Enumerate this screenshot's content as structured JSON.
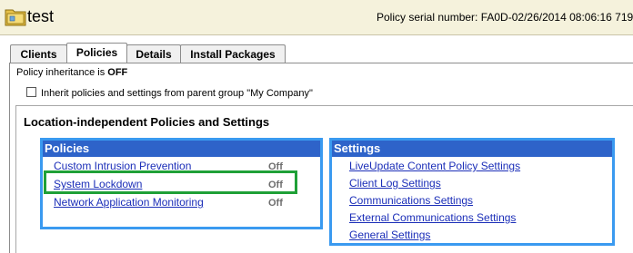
{
  "header": {
    "title": "test",
    "serial_label": "Policy serial number: FA0D-02/26/2014 08:06:16 719"
  },
  "tabs": [
    {
      "label": "Clients",
      "active": false
    },
    {
      "label": "Policies",
      "active": true
    },
    {
      "label": "Details",
      "active": false
    },
    {
      "label": "Install Packages",
      "active": false
    }
  ],
  "inheritance": {
    "status_prefix": "Policy inheritance is ",
    "status_value": "OFF",
    "checkbox_label": "Inherit policies and settings from parent group \"My Company\"",
    "checked": false
  },
  "section": {
    "title": "Location-independent Policies and Settings"
  },
  "policies": {
    "header": "Policies",
    "items": [
      {
        "label": "Custom Intrusion Prevention",
        "state": "Off"
      },
      {
        "label": "System Lockdown",
        "state": "Off"
      },
      {
        "label": "Network Application Monitoring",
        "state": "Off"
      }
    ]
  },
  "settings": {
    "header": "Settings",
    "items": [
      {
        "label": "LiveUpdate Content Policy Settings"
      },
      {
        "label": "Client Log Settings"
      },
      {
        "label": "Communications Settings"
      },
      {
        "label": "External Communications Settings"
      },
      {
        "label": "General Settings"
      }
    ]
  },
  "colors": {
    "header_bg": "#f5f2dc",
    "box_border": "#3a9af0",
    "box_header": "#2e63c9",
    "highlight": "#1fa037",
    "link": "#1b2eb8"
  }
}
